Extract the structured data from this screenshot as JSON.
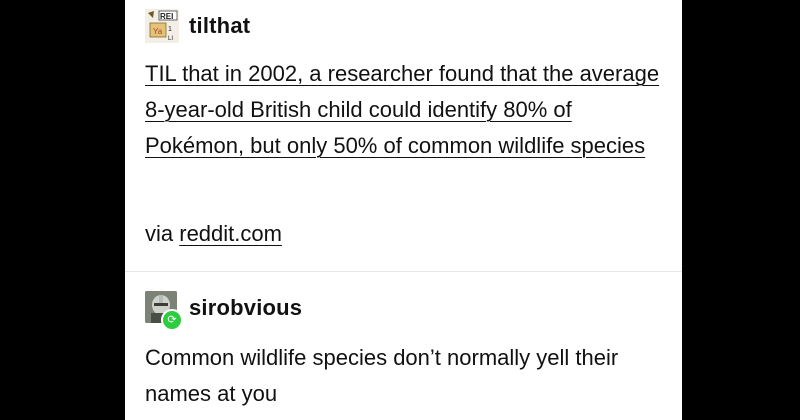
{
  "post": {
    "username": "tilthat",
    "avatar_icon": "rei-logo-avatar-icon",
    "text": "TIL that in 2002, a researcher found that the average 8-year-old British child could identify 80% of Pokémon, but only 50% of common wildlife species",
    "via_prefix": "via ",
    "via_link": "reddit.com"
  },
  "reblog": {
    "username": "sirobvious",
    "avatar_icon": "knight-helmet-avatar-icon",
    "badge_icon": "reblog-icon",
    "badge_color": "#2ecc40",
    "text": "Common wildlife species don’t normally yell their names at you"
  },
  "colors": {
    "background": "#000000",
    "card": "#ffffff",
    "text": "#111111"
  }
}
